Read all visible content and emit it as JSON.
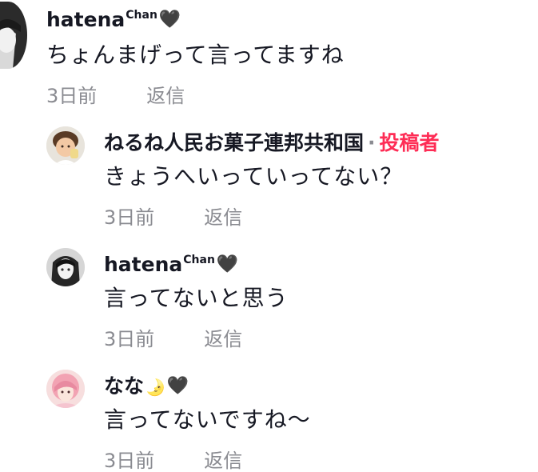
{
  "comments": [
    {
      "username": "hatena",
      "username_sup": "Chan",
      "heart": "🖤",
      "text": "ちょんまげって言ってますね",
      "time": "3日前",
      "reply_label": "返信"
    },
    {
      "username": "ねるね人民お菓子連邦共和国",
      "separator": "·",
      "author_tag": "投稿者",
      "text": "きょうへいっていってない？",
      "time": "3日前",
      "reply_label": "返信"
    },
    {
      "username": "hatena",
      "username_sup": "Chan",
      "heart": "🖤",
      "text": "言ってないと思う",
      "time": "3日前",
      "reply_label": "返信"
    },
    {
      "username": "なな",
      "moon": "🌛",
      "heart": "🖤",
      "text": "言ってないですね〜",
      "time": "3日前",
      "reply_label": "返信"
    }
  ],
  "colors": {
    "text": "#161823",
    "meta": "#8a8b91",
    "author_tag": "#fe2c55"
  },
  "icons": [
    "avatar-anime-girl",
    "avatar-child-photo",
    "avatar-anime-girl",
    "avatar-pink-hair",
    "black-heart",
    "crescent-moon"
  ]
}
